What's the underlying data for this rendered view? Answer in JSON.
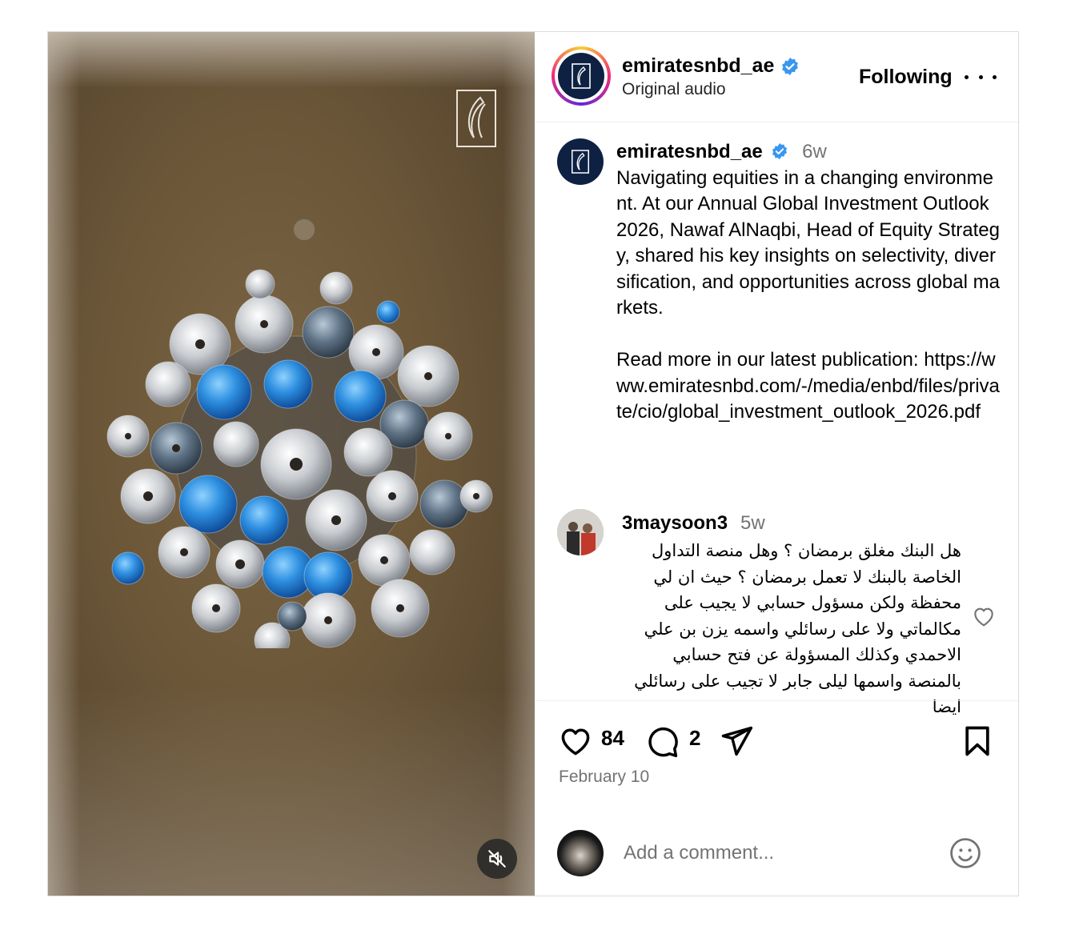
{
  "header": {
    "username": "emiratesnbd_ae",
    "verified": true,
    "audio": "Original audio",
    "follow_label": "Following"
  },
  "caption": {
    "username": "emiratesnbd_ae",
    "time": "6w",
    "text": "Navigating equities in a changing environment. At our Annual Global Investment Outlook 2026, Nawaf AlNaqbi, Head of Equity Strategy, shared his key insights on selectivity, diversification, and opportunities across global markets.\n\nRead more in our latest publication: https://www.emiratesnbd.com/-/media/enbd/files/private/cio/global_investment_outlook_2026.pdf"
  },
  "comment": {
    "username": "3maysoon3",
    "time": "5w",
    "text": "هل البنك مغلق برمضان ؟ وهل منصة التداول الخاصة بالبنك لا تعمل برمضان ؟ حيث ان لي محفظة ولكن مسؤول حسابي لا يجيب على مكالماتي ولا على رسائلي واسمه يزن بن علي الاحمدي وكذلك المسؤولة عن فتح حسابي بالمنصة واسمها ليلى جابر لا تجيب على رسائلي ايضا"
  },
  "actions": {
    "likes": "84",
    "comments": "2",
    "date": "February 10"
  },
  "add_comment": {
    "placeholder": "Add a comment..."
  },
  "icons": {
    "mute": "speaker-muted-icon",
    "like": "heart-icon",
    "comment": "speech-bubble-icon",
    "share": "paper-plane-icon",
    "save": "bookmark-icon",
    "emoji": "smiley-icon",
    "more": "ellipsis-icon",
    "verified": "verified-badge-icon"
  },
  "colors": {
    "brand_navy": "#0e2143",
    "verified_blue": "#3897f0",
    "muted_text": "#737373"
  }
}
